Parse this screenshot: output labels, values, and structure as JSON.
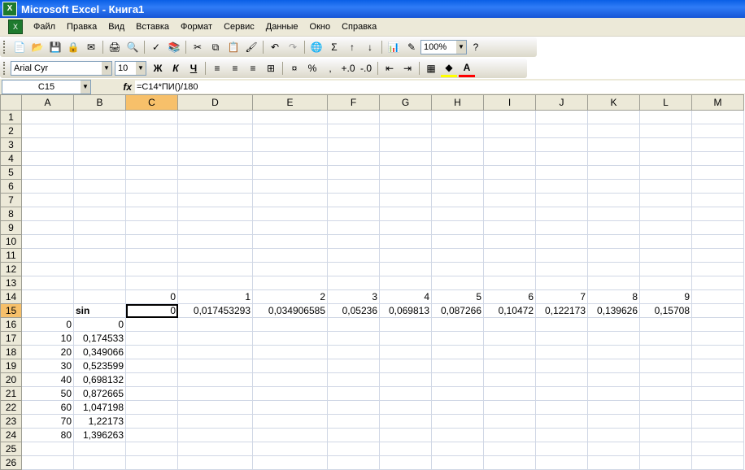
{
  "window": {
    "title": "Microsoft Excel - Книга1"
  },
  "menu": [
    "Файл",
    "Правка",
    "Вид",
    "Вставка",
    "Формат",
    "Сервис",
    "Данные",
    "Окно",
    "Справка"
  ],
  "toolbar": {
    "zoom": "100%"
  },
  "format_toolbar": {
    "font": "Arial Cyr",
    "size": "10",
    "bold": "Ж",
    "italic": "К",
    "underline": "Ч"
  },
  "formula_bar": {
    "cell_ref": "C15",
    "fx_label": "fx",
    "formula": "=C14*ПИ()/180"
  },
  "sheet": {
    "columns": [
      "A",
      "B",
      "C",
      "D",
      "E",
      "F",
      "G",
      "H",
      "I",
      "J",
      "K",
      "L",
      "M"
    ],
    "selected_column": "C",
    "selected_row": 15,
    "active_cell": "C15",
    "row_count": 26,
    "cells": {
      "C14": "0",
      "D14": "1",
      "E14": "2",
      "F14": "3",
      "G14": "4",
      "H14": "5",
      "I14": "6",
      "J14": "7",
      "K14": "8",
      "L14": "9",
      "B15": "sin",
      "C15": "0",
      "D15": "0,017453293",
      "E15": "0,034906585",
      "F15": "0,05236",
      "G15": "0,069813",
      "H15": "0,087266",
      "I15": "0,10472",
      "J15": "0,122173",
      "K15": "0,139626",
      "L15": "0,15708",
      "A16": "0",
      "B16": "0",
      "A17": "10",
      "B17": "0,174533",
      "A18": "20",
      "B18": "0,349066",
      "A19": "30",
      "B19": "0,523599",
      "A20": "40",
      "B20": "0,698132",
      "A21": "50",
      "B21": "0,872665",
      "A22": "60",
      "B22": "1,047198",
      "A23": "70",
      "B23": "1,22173",
      "A24": "80",
      "B24": "1,396263"
    }
  }
}
